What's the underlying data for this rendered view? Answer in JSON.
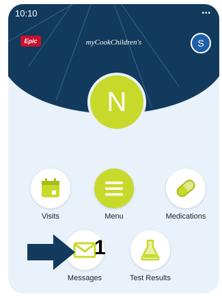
{
  "status": {
    "time": "10:10",
    "signal": "•••"
  },
  "header": {
    "logo": "Epic",
    "brand": "myCookChildren's",
    "profile_initial": "S"
  },
  "user": {
    "initial": "N"
  },
  "tiles": [
    {
      "label": "Visits",
      "icon": "calendar-icon"
    },
    {
      "label": "Menu",
      "icon": "menu-icon"
    },
    {
      "label": "Medications",
      "icon": "pill-icon"
    },
    {
      "label": "Messages",
      "icon": "envelope-icon"
    },
    {
      "label": "Test Results",
      "icon": "flask-icon"
    }
  ],
  "annotation": {
    "number": "1"
  },
  "colors": {
    "navy": "#123a5c",
    "lime": "#c7da2b",
    "background": "#e9f1fa"
  }
}
